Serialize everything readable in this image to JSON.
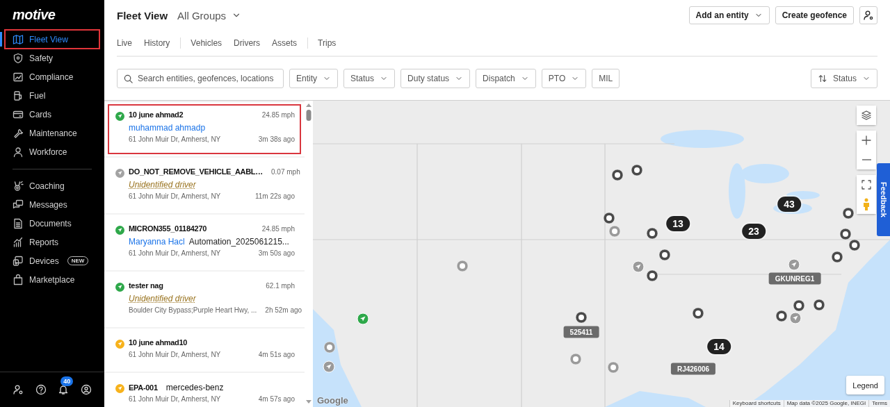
{
  "logo": "motive",
  "sidebar": {
    "sections": [
      [
        {
          "label": "Fleet View",
          "selected": true,
          "highlighted": true
        },
        {
          "label": "Safety",
          "selected": false,
          "highlighted": false
        },
        {
          "label": "Compliance",
          "selected": false,
          "highlighted": false
        },
        {
          "label": "Fuel",
          "selected": false,
          "highlighted": false
        },
        {
          "label": "Cards",
          "selected": false,
          "highlighted": false
        },
        {
          "label": "Maintenance",
          "selected": false,
          "highlighted": false
        },
        {
          "label": "Workforce",
          "selected": false,
          "highlighted": false
        }
      ],
      [
        {
          "label": "Coaching",
          "selected": false,
          "highlighted": false
        },
        {
          "label": "Messages",
          "selected": false,
          "highlighted": false
        },
        {
          "label": "Documents",
          "selected": false,
          "highlighted": false
        },
        {
          "label": "Reports",
          "selected": false,
          "highlighted": false
        },
        {
          "label": "Devices",
          "selected": false,
          "highlighted": false,
          "badge": "NEW"
        },
        {
          "label": "Marketplace",
          "selected": false,
          "highlighted": false
        }
      ]
    ],
    "notification_count": "40"
  },
  "header": {
    "title": "Fleet View",
    "group_picker": "All Groups",
    "actions": [
      {
        "label": "Add an entity",
        "dropdown": true
      },
      {
        "label": "Create geofence",
        "dropdown": false
      }
    ],
    "tab_groups": [
      [
        "Live",
        "History"
      ],
      [
        "Vehicles",
        "Drivers",
        "Assets"
      ],
      [
        "Trips"
      ]
    ],
    "search": {
      "placeholder": "Search entities, geofences, locations"
    },
    "filters": [
      {
        "label": "Entity",
        "dropdown": true
      },
      {
        "label": "Status",
        "dropdown": true
      },
      {
        "label": "Duty status",
        "dropdown": true
      },
      {
        "label": "Dispatch",
        "dropdown": true
      },
      {
        "label": "PTO",
        "dropdown": true
      },
      {
        "label": "MIL",
        "dropdown": false
      }
    ],
    "sort": {
      "label": "Status"
    }
  },
  "vehicles": [
    {
      "name": "10 june ahmad2",
      "color": "#2ea84a",
      "speed": "24.85 mph",
      "driver": "muhammad ahmadp",
      "driver_unidentified": false,
      "location": "61 John Muir Dr, Amherst, NY",
      "time": "3m 38s ago",
      "highlighted": true
    },
    {
      "name": "DO_NOT_REMOVE_VEHICLE_AABL…",
      "color": "#a3a3a3",
      "speed": "0.07 mph",
      "driver": "Unidentified driver",
      "driver_unidentified": true,
      "location": "61 John Muir Dr, Amherst, NY",
      "time": "11m 22s ago",
      "highlighted": false
    },
    {
      "name": "MICRON355_01184270",
      "color": "#2ea84a",
      "speed": "24.85 mph",
      "driver": "Maryanna Hacl",
      "driver_unidentified": false,
      "extra": "Automation_2025061215...",
      "location": "61 John Muir Dr, Amherst, NY",
      "time": "3m 50s ago",
      "highlighted": false
    },
    {
      "name": "tester nag",
      "color": "#2ea84a",
      "speed": "62.1 mph",
      "driver": "Unidentified driver",
      "driver_unidentified": true,
      "location": "Boulder City Bypass;Purple Heart Hwy, ...",
      "time": "2h 52m ago",
      "highlighted": false
    },
    {
      "name": "10 june ahmad10",
      "color": "#f7b21b",
      "location": "61 John Muir Dr, Amherst, NY",
      "time": "4m 51s ago",
      "highlighted": false
    },
    {
      "name": "EPA-001",
      "model": "mercedes-benz",
      "color": "#f7b21b",
      "location": "61 John Muir Dr, Amherst, NY",
      "time": "4m 57s ago",
      "highlighted": false
    }
  ],
  "map": {
    "clusters": [
      {
        "count": "43"
      },
      {
        "count": "13"
      },
      {
        "count": "23"
      },
      {
        "count": "14"
      }
    ],
    "vehicle_labels": [
      {
        "label": "GKUNREG1"
      },
      {
        "label": "525411"
      },
      {
        "label": "RJ426006"
      }
    ],
    "legend_button": "Legend",
    "feedback": "Feedback",
    "google_logo": "Google",
    "attribution": [
      "Keyboard shortcuts",
      "Map data ©2025 Google, INEGI",
      "Terms"
    ]
  }
}
